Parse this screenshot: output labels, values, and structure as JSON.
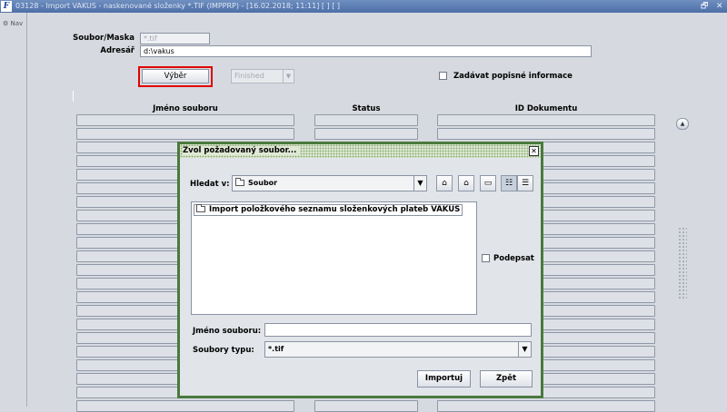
{
  "window": {
    "title": "03128 - Import VAKUS - naskenované složenky *.TIF (IMPPRP) - [16.02.2018; 11:11]  [ ]  [ ]",
    "restore_symbol": "🗗",
    "close_symbol": "✕"
  },
  "left_rail": {
    "nav_label": "Nav"
  },
  "form": {
    "mask_label": "Soubor/Maska",
    "mask_value": "*.tif",
    "dir_label": "Adresář",
    "dir_value": "d:\\vakus",
    "select_button": "Výběr",
    "status_combo": "Finished",
    "describe_checkbox_label": "Zadávat popisné informace"
  },
  "table": {
    "columns": [
      "Jméno souboru",
      "Status",
      "ID Dokumentu"
    ],
    "rows": 22
  },
  "dialog": {
    "title": "Zvol požadovaný soubor...",
    "look_in_label": "Hledat v:",
    "look_in_value": "Soubor",
    "files": [
      "Import položkového seznamu složenkových plateb VAKUS"
    ],
    "sign_label": "Podepsat",
    "filename_label": "Jméno souboru:",
    "filename_value": "",
    "filetype_label": "Soubory typu:",
    "filetype_value": "*.tif",
    "import_button": "Importuj",
    "back_button": "Zpět",
    "toolbar_icons": [
      "up-folder-icon",
      "home-icon",
      "new-folder-icon",
      "list-view-icon",
      "details-view-icon"
    ]
  },
  "colors": {
    "titlebar": "#4d6fa8",
    "dialog_border": "#4a7a3d",
    "highlight": "#e00000",
    "background": "#d6d9df"
  }
}
